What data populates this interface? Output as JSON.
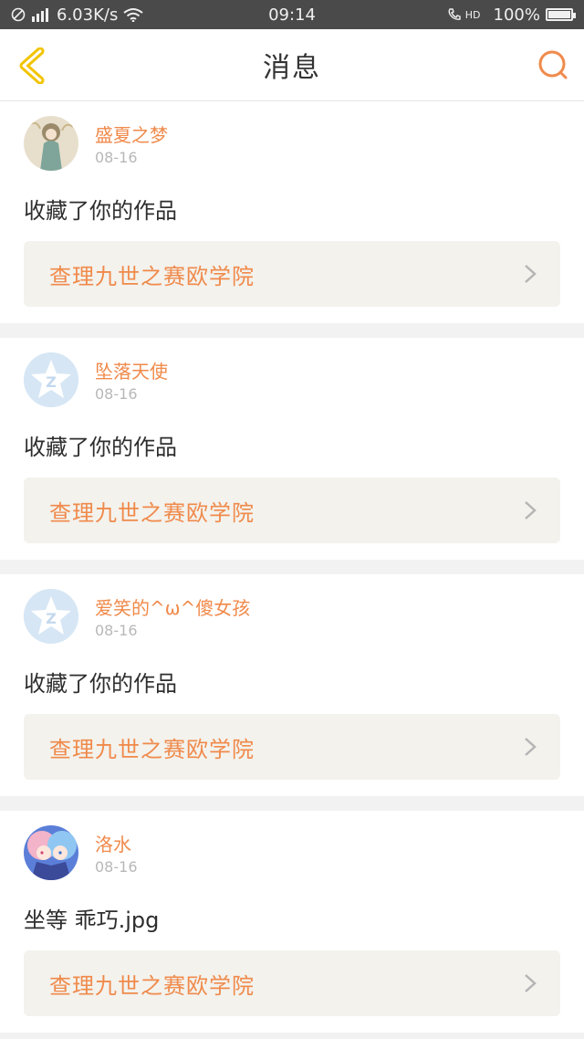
{
  "status_bar": {
    "network_speed": "6.03K/s",
    "time": "09:14",
    "hd_label": "HD",
    "battery": "100%"
  },
  "nav": {
    "title": "消息"
  },
  "colors": {
    "accent": "#f08a4b",
    "back_icon": "#f2c400",
    "card_bg": "#f3f2ed"
  },
  "messages": [
    {
      "username": "盛夏之梦",
      "date": "08-16",
      "action": "收藏了你的作品",
      "work_title": "查理九世之赛欧学院",
      "avatar": "illustrated-girl"
    },
    {
      "username": "坠落天使",
      "date": "08-16",
      "action": "收藏了你的作品",
      "work_title": "查理九世之赛欧学院",
      "avatar": "default-qzone"
    },
    {
      "username": "爱笑的^ω^傻女孩",
      "date": "08-16",
      "action": "收藏了你的作品",
      "work_title": "查理九世之赛欧学院",
      "avatar": "default-qzone"
    },
    {
      "username": "洛水",
      "date": "08-16",
      "action": "坐等 乖巧.jpg",
      "work_title": "查理九世之赛欧学院",
      "avatar": "anime-girls"
    }
  ]
}
